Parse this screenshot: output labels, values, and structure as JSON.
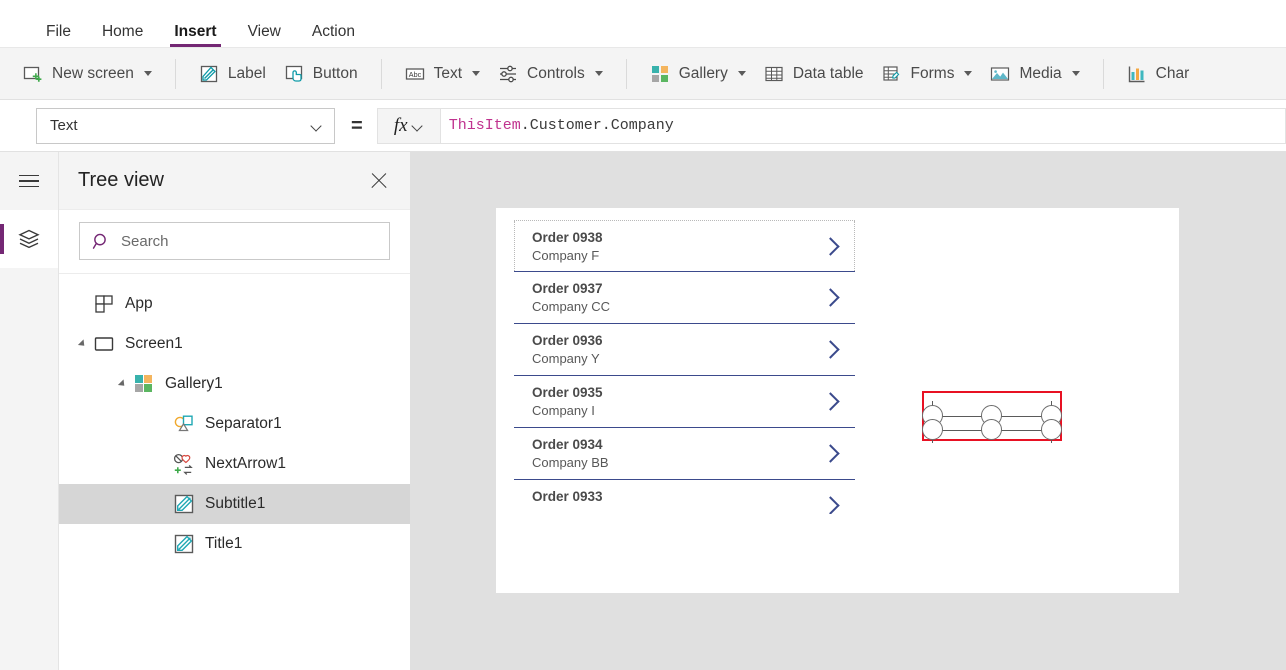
{
  "app": {
    "title": "Power Apps Studio",
    "accent_purple": "#742774",
    "selection_red": "#e81123",
    "gallery_accent": "#3b4a8c"
  },
  "menubar": {
    "tabs": [
      {
        "label": "File",
        "active": false
      },
      {
        "label": "Home",
        "active": false
      },
      {
        "label": "Insert",
        "active": true
      },
      {
        "label": "View",
        "active": false
      },
      {
        "label": "Action",
        "active": false
      }
    ]
  },
  "ribbon": {
    "items": [
      {
        "label": "New screen",
        "icon": "new-screen-icon",
        "caret": true
      },
      {
        "label": "Label",
        "icon": "label-icon",
        "caret": false
      },
      {
        "label": "Button",
        "icon": "button-icon",
        "caret": false
      },
      {
        "label": "Text",
        "icon": "text-icon",
        "caret": true
      },
      {
        "label": "Controls",
        "icon": "controls-icon",
        "caret": true
      },
      {
        "label": "Gallery",
        "icon": "gallery-icon",
        "caret": true
      },
      {
        "label": "Data table",
        "icon": "data-table-icon",
        "caret": false
      },
      {
        "label": "Forms",
        "icon": "forms-icon",
        "caret": true
      },
      {
        "label": "Media",
        "icon": "media-icon",
        "caret": true
      },
      {
        "label": "Char",
        "icon": "charts-icon",
        "caret": false
      }
    ]
  },
  "formula_bar": {
    "property": "Text",
    "equals": "=",
    "fx_label": "fx",
    "formula_object": "ThisItem",
    "formula_rest": ".Customer.Company",
    "formula_full": "ThisItem.Customer.Company"
  },
  "rail": {
    "menu_icon": "hamburger-icon",
    "tree_icon": "layers-icon"
  },
  "tree_panel": {
    "title": "Tree view",
    "close_label": "Close",
    "search": {
      "value": "",
      "placeholder": "Search"
    },
    "items": [
      {
        "label": "App",
        "icon": "app-icon",
        "depth": 0,
        "arrow": "none",
        "selected": false
      },
      {
        "label": "Screen1",
        "icon": "screen-icon",
        "depth": 0,
        "arrow": "open",
        "selected": false
      },
      {
        "label": "Gallery1",
        "icon": "gallery-icon",
        "depth": 1,
        "arrow": "open",
        "selected": false
      },
      {
        "label": "Separator1",
        "icon": "separator-icon",
        "depth": 2,
        "arrow": "none",
        "selected": false
      },
      {
        "label": "NextArrow1",
        "icon": "nextarrow-icon",
        "depth": 2,
        "arrow": "none",
        "selected": false
      },
      {
        "label": "Subtitle1",
        "icon": "label-edit-icon",
        "depth": 2,
        "arrow": "none",
        "selected": true
      },
      {
        "label": "Title1",
        "icon": "label-edit-icon",
        "depth": 2,
        "arrow": "none",
        "selected": false
      }
    ]
  },
  "canvas": {
    "gallery": {
      "rows": [
        {
          "title": "Order 0938",
          "subtitle": "Company F",
          "template": true,
          "clipped": false,
          "selected": true
        },
        {
          "title": "Order 0937",
          "subtitle": "Company CC",
          "template": false,
          "clipped": false,
          "selected": false
        },
        {
          "title": "Order 0936",
          "subtitle": "Company Y",
          "template": false,
          "clipped": false,
          "selected": false
        },
        {
          "title": "Order 0935",
          "subtitle": "Company I",
          "template": false,
          "clipped": false,
          "selected": false
        },
        {
          "title": "Order 0934",
          "subtitle": "Company BB",
          "template": false,
          "clipped": false,
          "selected": false
        },
        {
          "title": "Order 0933",
          "subtitle": "",
          "template": false,
          "clipped": true,
          "selected": false
        }
      ]
    }
  }
}
